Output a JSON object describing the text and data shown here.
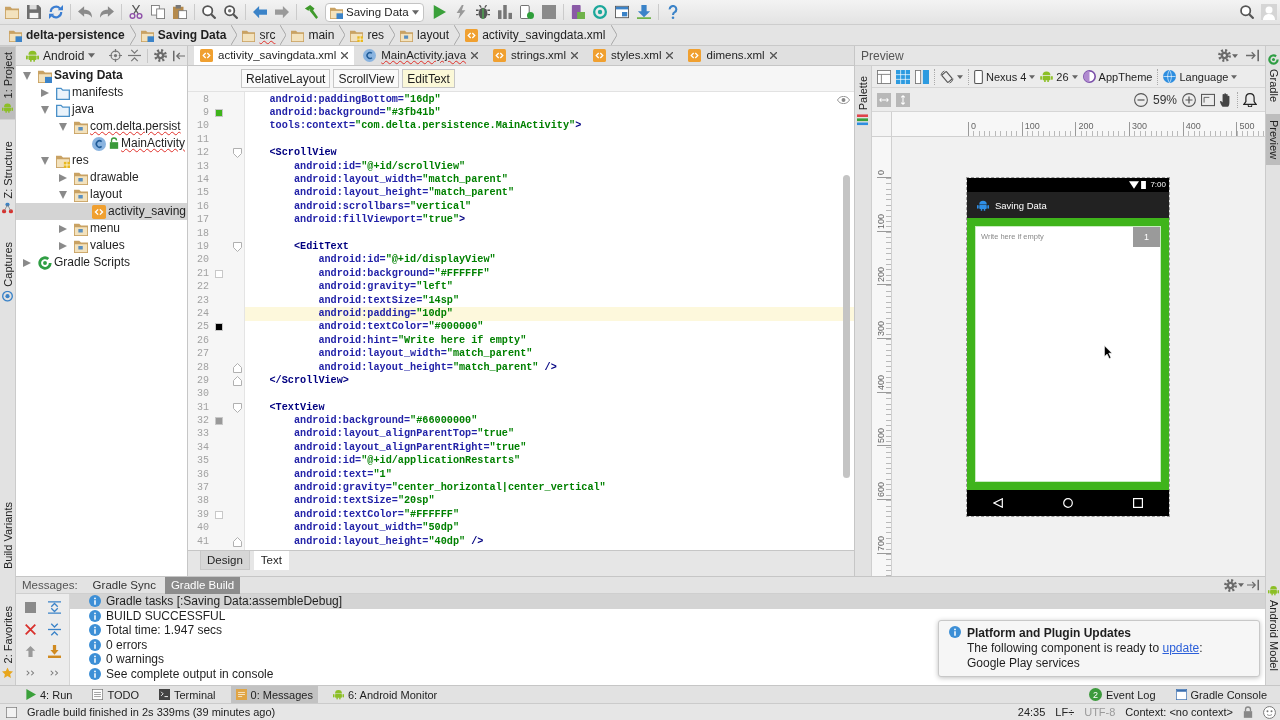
{
  "toolbar": {
    "run_config": "Saving Data"
  },
  "navbar": [
    {
      "label": "delta-persistence",
      "kind": "project",
      "error": false
    },
    {
      "label": "Saving Data",
      "kind": "module",
      "error": false
    },
    {
      "label": "src",
      "kind": "folder",
      "error": true
    },
    {
      "label": "main",
      "kind": "folder",
      "error": false
    },
    {
      "label": "res",
      "kind": "res",
      "error": false
    },
    {
      "label": "layout",
      "kind": "package",
      "error": false
    },
    {
      "label": "activity_savingdata.xml",
      "kind": "xml",
      "error": false
    }
  ],
  "left_tool_tabs_top": [
    {
      "label": "1: Project",
      "selected": true
    },
    {
      "label": "Z: Structure",
      "selected": false
    },
    {
      "label": "Captures",
      "selected": false
    }
  ],
  "left_tool_tabs_bottom": [
    {
      "label": "Build Variants",
      "selected": false
    },
    {
      "label": "2: Favorites",
      "selected": false
    }
  ],
  "right_tool_tabs_top": [
    {
      "label": "Gradle",
      "selected": false
    },
    {
      "label": "Preview",
      "selected": true
    }
  ],
  "right_tool_tabs_bottom": [
    {
      "label": "Android Model",
      "selected": false
    }
  ],
  "project": {
    "view": "Android",
    "tree": [
      {
        "label": "Saving Data",
        "kind": "module",
        "expanded": true,
        "selected": false,
        "error": false,
        "children": [
          {
            "label": "manifests",
            "kind": "source-folder",
            "expanded": false,
            "selected": false,
            "error": false
          },
          {
            "label": "java",
            "kind": "source-folder",
            "expanded": true,
            "selected": false,
            "error": false,
            "children": [
              {
                "label": "com.delta.persist",
                "kind": "package",
                "expanded": true,
                "selected": false,
                "error": true,
                "children": [
                  {
                    "label": "MainActivity",
                    "kind": "class",
                    "selected": false,
                    "error": true
                  }
                ]
              }
            ]
          },
          {
            "label": "res",
            "kind": "res",
            "expanded": true,
            "selected": false,
            "error": false,
            "children": [
              {
                "label": "drawable",
                "kind": "package",
                "expanded": false,
                "selected": false,
                "error": false
              },
              {
                "label": "layout",
                "kind": "package",
                "expanded": true,
                "selected": false,
                "error": false,
                "children": [
                  {
                    "label": "activity_saving",
                    "kind": "xml",
                    "selected": true,
                    "error": false
                  }
                ]
              },
              {
                "label": "menu",
                "kind": "package",
                "expanded": false,
                "selected": false,
                "error": false
              },
              {
                "label": "values",
                "kind": "package",
                "expanded": false,
                "selected": false,
                "error": false
              }
            ]
          }
        ]
      },
      {
        "label": "Gradle Scripts",
        "kind": "gradle",
        "expanded": false,
        "selected": false,
        "error": false
      }
    ]
  },
  "editor": {
    "tabs": [
      {
        "label": "activity_savingdata.xml",
        "kind": "xml",
        "selected": true,
        "error": false
      },
      {
        "label": "MainActivity.java",
        "kind": "class",
        "selected": false,
        "error": true
      },
      {
        "label": "strings.xml",
        "kind": "xml",
        "selected": false,
        "error": false
      },
      {
        "label": "styles.xml",
        "kind": "xml",
        "selected": false,
        "error": false
      },
      {
        "label": "dimens.xml",
        "kind": "xml",
        "selected": false,
        "error": false
      }
    ],
    "breadcrumbs": [
      {
        "label": "RelativeLayout",
        "selected": false
      },
      {
        "label": "ScrollView",
        "selected": false
      },
      {
        "label": "EditText",
        "selected": true
      }
    ],
    "lines": [
      {
        "number": "8",
        "kind": "plain",
        "current": false,
        "tokens": [
          {
            "kind": "attr",
            "text": "    android:paddingBottom"
          },
          {
            "kind": "eq",
            "text": "="
          },
          {
            "kind": "value",
            "text": "\"16dp\""
          }
        ]
      },
      {
        "number": "9",
        "kind": "plain",
        "current": false,
        "color": "#3fb41b",
        "tokens": [
          {
            "kind": "attr",
            "text": "    android:background"
          },
          {
            "kind": "eq",
            "text": "="
          },
          {
            "kind": "value",
            "text": "\"#3fb41b\""
          }
        ]
      },
      {
        "number": "10",
        "kind": "plain",
        "current": false,
        "tokens": [
          {
            "kind": "attr",
            "text": "    tools:context"
          },
          {
            "kind": "eq",
            "text": "="
          },
          {
            "kind": "value",
            "text": "\"com.delta.persistence.MainActivity\""
          },
          {
            "kind": "punct",
            "text": ">"
          }
        ]
      },
      {
        "number": "11",
        "kind": "plain",
        "current": false
      },
      {
        "number": "12",
        "kind": "fold-start",
        "current": false,
        "tokens": [
          {
            "kind": "tag",
            "text": "    <ScrollView"
          }
        ]
      },
      {
        "number": "13",
        "kind": "plain",
        "current": false,
        "tokens": [
          {
            "kind": "attr",
            "text": "        android:id"
          },
          {
            "kind": "eq",
            "text": "="
          },
          {
            "kind": "value",
            "text": "\"@+id/scrollView\""
          }
        ]
      },
      {
        "number": "14",
        "kind": "plain",
        "current": false,
        "tokens": [
          {
            "kind": "attr",
            "text": "        android:layout_width"
          },
          {
            "kind": "eq",
            "text": "="
          },
          {
            "kind": "value",
            "text": "\"match_parent\""
          }
        ]
      },
      {
        "number": "15",
        "kind": "plain",
        "current": false,
        "tokens": [
          {
            "kind": "attr",
            "text": "        android:layout_height"
          },
          {
            "kind": "eq",
            "text": "="
          },
          {
            "kind": "value",
            "text": "\"match_parent\""
          }
        ]
      },
      {
        "number": "16",
        "kind": "plain",
        "current": false,
        "tokens": [
          {
            "kind": "attr",
            "text": "        android:scrollbars"
          },
          {
            "kind": "eq",
            "text": "="
          },
          {
            "kind": "value",
            "text": "\"vertical\""
          }
        ]
      },
      {
        "number": "17",
        "kind": "plain",
        "current": false,
        "tokens": [
          {
            "kind": "attr",
            "text": "        android:fillViewport"
          },
          {
            "kind": "eq",
            "text": "="
          },
          {
            "kind": "value",
            "text": "\"true\""
          },
          {
            "kind": "punct",
            "text": ">"
          }
        ]
      },
      {
        "number": "18",
        "kind": "plain",
        "current": false
      },
      {
        "number": "19",
        "kind": "fold-start",
        "current": false,
        "tokens": [
          {
            "kind": "tag",
            "text": "        <EditText"
          }
        ]
      },
      {
        "number": "20",
        "kind": "plain",
        "current": false,
        "tokens": [
          {
            "kind": "attr",
            "text": "            android:id"
          },
          {
            "kind": "eq",
            "text": "="
          },
          {
            "kind": "value",
            "text": "\"@+id/displayView\""
          }
        ]
      },
      {
        "number": "21",
        "kind": "plain",
        "current": false,
        "color": "#ffffff",
        "tokens": [
          {
            "kind": "attr",
            "text": "            android:background"
          },
          {
            "kind": "eq",
            "text": "="
          },
          {
            "kind": "value",
            "text": "\"#FFFFFF\""
          }
        ]
      },
      {
        "number": "22",
        "kind": "plain",
        "current": false,
        "tokens": [
          {
            "kind": "attr",
            "text": "            android:gravity"
          },
          {
            "kind": "eq",
            "text": "="
          },
          {
            "kind": "value",
            "text": "\"left\""
          }
        ]
      },
      {
        "number": "23",
        "kind": "plain",
        "current": false,
        "tokens": [
          {
            "kind": "attr",
            "text": "            android:textSize"
          },
          {
            "kind": "eq",
            "text": "="
          },
          {
            "kind": "value",
            "text": "\"14sp\""
          }
        ]
      },
      {
        "number": "24",
        "kind": "plain",
        "current": true,
        "tokens": [
          {
            "kind": "attr",
            "text": "            android:padding"
          },
          {
            "kind": "eq",
            "text": "="
          },
          {
            "kind": "value",
            "text": "\"10dp\""
          }
        ]
      },
      {
        "number": "25",
        "kind": "plain",
        "current": false,
        "color": "#000000",
        "tokens": [
          {
            "kind": "attr",
            "text": "            android:textColor"
          },
          {
            "kind": "eq",
            "text": "="
          },
          {
            "kind": "value",
            "text": "\"#000000\""
          }
        ]
      },
      {
        "number": "26",
        "kind": "plain",
        "current": false,
        "tokens": [
          {
            "kind": "attr",
            "text": "            android:hint"
          },
          {
            "kind": "eq",
            "text": "="
          },
          {
            "kind": "value",
            "text": "\"Write here if empty\""
          }
        ]
      },
      {
        "number": "27",
        "kind": "plain",
        "current": false,
        "tokens": [
          {
            "kind": "attr",
            "text": "            android:layout_width"
          },
          {
            "kind": "eq",
            "text": "="
          },
          {
            "kind": "value",
            "text": "\"match_parent\""
          }
        ]
      },
      {
        "number": "28",
        "kind": "fold-end",
        "current": false,
        "tokens": [
          {
            "kind": "attr",
            "text": "            android:layout_height"
          },
          {
            "kind": "eq",
            "text": "="
          },
          {
            "kind": "value",
            "text": "\"match_parent\""
          },
          {
            "kind": "punct",
            "text": " />"
          }
        ]
      },
      {
        "number": "29",
        "kind": "fold-end",
        "current": false,
        "tokens": [
          {
            "kind": "tag",
            "text": "    </ScrollView>"
          }
        ]
      },
      {
        "number": "30",
        "kind": "plain",
        "current": false
      },
      {
        "number": "31",
        "kind": "fold-start",
        "current": false,
        "tokens": [
          {
            "kind": "tag",
            "text": "    <TextView"
          }
        ]
      },
      {
        "number": "32",
        "kind": "plain",
        "current": false,
        "color": "#999999",
        "tokens": [
          {
            "kind": "attr",
            "text": "        android:background"
          },
          {
            "kind": "eq",
            "text": "="
          },
          {
            "kind": "value",
            "text": "\"#66000000\""
          }
        ]
      },
      {
        "number": "33",
        "kind": "plain",
        "current": false,
        "tokens": [
          {
            "kind": "attr",
            "text": "        android:layout_alignParentTop"
          },
          {
            "kind": "eq",
            "text": "="
          },
          {
            "kind": "value",
            "text": "\"true\""
          }
        ]
      },
      {
        "number": "34",
        "kind": "plain",
        "current": false,
        "tokens": [
          {
            "kind": "attr",
            "text": "        android:layout_alignParentRight"
          },
          {
            "kind": "eq",
            "text": "="
          },
          {
            "kind": "value",
            "text": "\"true\""
          }
        ]
      },
      {
        "number": "35",
        "kind": "plain",
        "current": false,
        "tokens": [
          {
            "kind": "attr",
            "text": "        android:id"
          },
          {
            "kind": "eq",
            "text": "="
          },
          {
            "kind": "value",
            "text": "\"@+id/applicationRestarts\""
          }
        ]
      },
      {
        "number": "36",
        "kind": "plain",
        "current": false,
        "tokens": [
          {
            "kind": "attr",
            "text": "        android:text"
          },
          {
            "kind": "eq",
            "text": "="
          },
          {
            "kind": "value",
            "text": "\"1\""
          }
        ]
      },
      {
        "number": "37",
        "kind": "plain",
        "current": false,
        "tokens": [
          {
            "kind": "attr",
            "text": "        android:gravity"
          },
          {
            "kind": "eq",
            "text": "="
          },
          {
            "kind": "value",
            "text": "\"center_horizontal|center_vertical\""
          }
        ]
      },
      {
        "number": "38",
        "kind": "plain",
        "current": false,
        "tokens": [
          {
            "kind": "attr",
            "text": "        android:textSize"
          },
          {
            "kind": "eq",
            "text": "="
          },
          {
            "kind": "value",
            "text": "\"20sp\""
          }
        ]
      },
      {
        "number": "39",
        "kind": "plain",
        "current": false,
        "color": "#ffffff",
        "tokens": [
          {
            "kind": "attr",
            "text": "        android:textColor"
          },
          {
            "kind": "eq",
            "text": "="
          },
          {
            "kind": "value",
            "text": "\"#FFFFFF\""
          }
        ]
      },
      {
        "number": "40",
        "kind": "plain",
        "current": false,
        "tokens": [
          {
            "kind": "attr",
            "text": "        android:layout_width"
          },
          {
            "kind": "eq",
            "text": "="
          },
          {
            "kind": "value",
            "text": "\"50dp\""
          }
        ]
      },
      {
        "number": "41",
        "kind": "fold-end",
        "current": false,
        "tokens": [
          {
            "kind": "attr",
            "text": "        android:layout_height"
          },
          {
            "kind": "eq",
            "text": "="
          },
          {
            "kind": "value",
            "text": "\"40dp\""
          },
          {
            "kind": "punct",
            "text": " />"
          }
        ]
      }
    ],
    "mode_tabs": [
      {
        "label": "Design",
        "selected": false
      },
      {
        "label": "Text",
        "selected": true
      }
    ]
  },
  "preview": {
    "title": "Preview",
    "palette": "Palette",
    "device": "Nexus 4",
    "api_level": "26",
    "theme": "AppTheme",
    "language": "Language",
    "zoom": "59%",
    "ruler": {
      "x_labels": [
        "0",
        "100",
        "200",
        "300",
        "400",
        "500"
      ],
      "y_labels": [
        "0",
        "100",
        "200",
        "300",
        "400",
        "500",
        "600",
        "700"
      ]
    },
    "phone": {
      "time": "7:00",
      "app_title": "Saving Data",
      "placeholder": "Write here if empty",
      "counter": "1"
    }
  },
  "messages": {
    "label": "Messages:",
    "tabs": [
      {
        "label": "Gradle Sync",
        "selected": false
      },
      {
        "label": "Gradle Build",
        "selected": true
      }
    ],
    "rows": [
      {
        "text": "Gradle tasks [:Saving Data:assembleDebug]",
        "selected": true
      },
      {
        "text": "BUILD SUCCESSFUL",
        "selected": false
      },
      {
        "text": "Total time: 1.947 secs",
        "selected": false
      },
      {
        "text": "0 errors",
        "selected": false
      },
      {
        "text": "0 warnings",
        "selected": false
      },
      {
        "text": "See complete output in console",
        "selected": false
      }
    ]
  },
  "notification": {
    "title": "Platform and Plugin Updates",
    "text": "The following component is ready to",
    "link": "update",
    "text_end": ":",
    "detail": "Google Play services"
  },
  "tool_window_bar": {
    "left": [
      {
        "label": "4: Run",
        "selected": false
      },
      {
        "label": "TODO",
        "selected": false
      },
      {
        "label": "Terminal",
        "selected": false
      },
      {
        "label": "0: Messages",
        "selected": true
      },
      {
        "label": "6: Android Monitor",
        "selected": false
      }
    ],
    "right": [
      {
        "label": "Event Log",
        "badge": "2",
        "selected": false
      },
      {
        "label": "Gradle Console",
        "selected": false
      }
    ]
  },
  "status_bar": {
    "message": "Gradle build finished in 2s 339ms (39 minutes ago)",
    "position": "24:35",
    "line_separator": "LF÷",
    "encoding": {
      "label": "UTF-8",
      "disabled": true
    },
    "context": "Context: <no context>"
  }
}
